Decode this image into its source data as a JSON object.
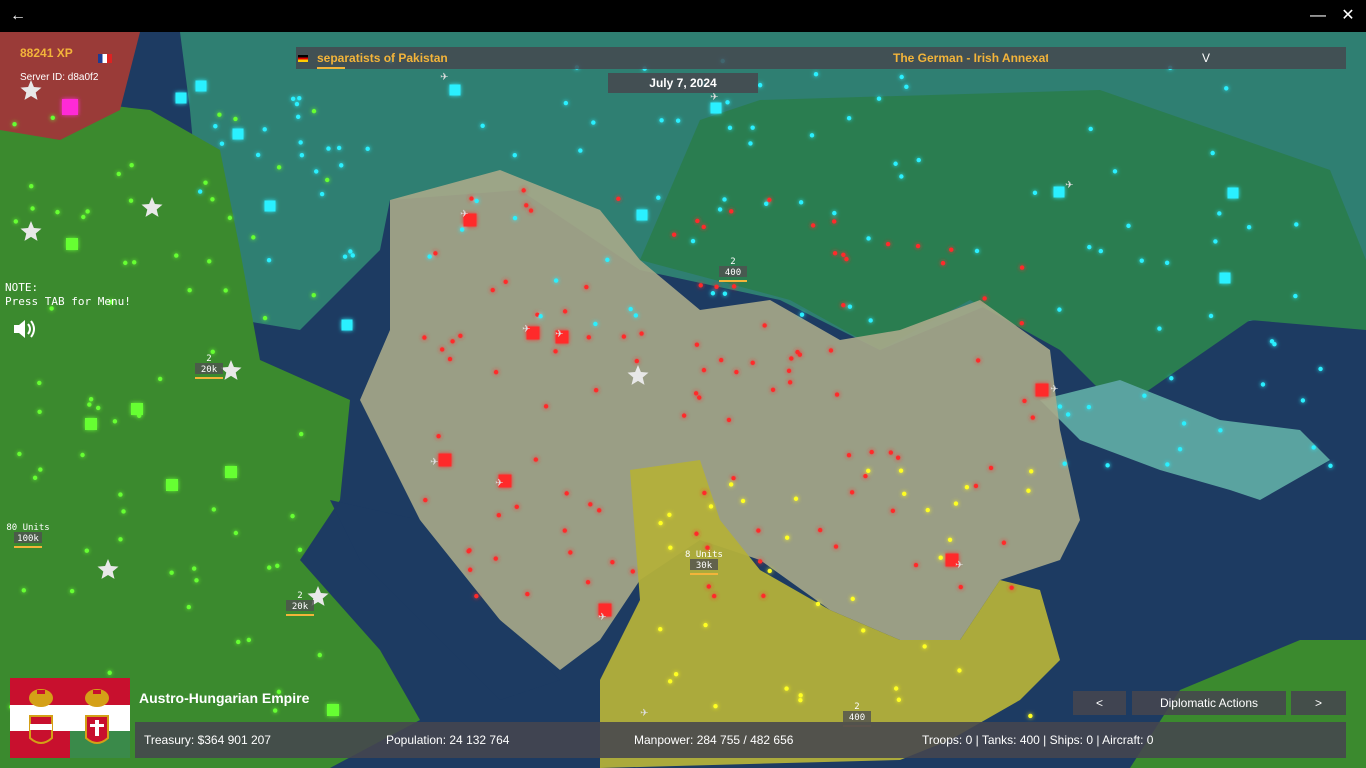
{
  "titlebar": {
    "back_icon": "arrow-left-icon",
    "minimize_icon": "minimize-icon",
    "close_icon": "close-icon"
  },
  "hud": {
    "xp": "88241 XP",
    "server_id": "Server ID: d8a0f2",
    "note": "NOTE:\nPress TAB for Menu!",
    "sound_icon": "speaker-icon"
  },
  "ticker": {
    "left_text": "separatists of Pakistan",
    "right_text": "The German - Irish Annexation",
    "right_mark": "V"
  },
  "date": "July 7, 2024",
  "player": {
    "nation": "Austro-Hungarian Empire",
    "treasury": "Treasury:  $364 901 207",
    "population": "Population: 24 132 764",
    "manpower": "Manpower:  284 755  /  482 656",
    "military": "Troops: 0  |  Tanks: 400  |  Ships: 0  |  Aircraft: 0"
  },
  "diplomacy": {
    "prev": "<",
    "label": "Diplomatic Actions",
    "next": ">"
  },
  "units": [
    {
      "count": "2",
      "strength": "400"
    },
    {
      "count": "2",
      "strength": "20k"
    },
    {
      "count": "80 Units",
      "strength": "100k"
    },
    {
      "count": "2",
      "strength": "20k"
    },
    {
      "count": "8 Units",
      "strength": "30k"
    },
    {
      "count": "2",
      "strength": "400"
    }
  ],
  "colors": {
    "austria": "#b8b89a",
    "germany_teal": "#2f8a7c",
    "russia_green": "#2a8a52",
    "italy_green": "#3a8a2a",
    "balkans_yellow": "#b8b43a",
    "dots_red": "#ff2a2a",
    "dots_cyan": "#2af0ff",
    "dots_green": "#66ff33",
    "dots_yellow": "#ffff22",
    "xp_orange": "#f3b43a"
  }
}
